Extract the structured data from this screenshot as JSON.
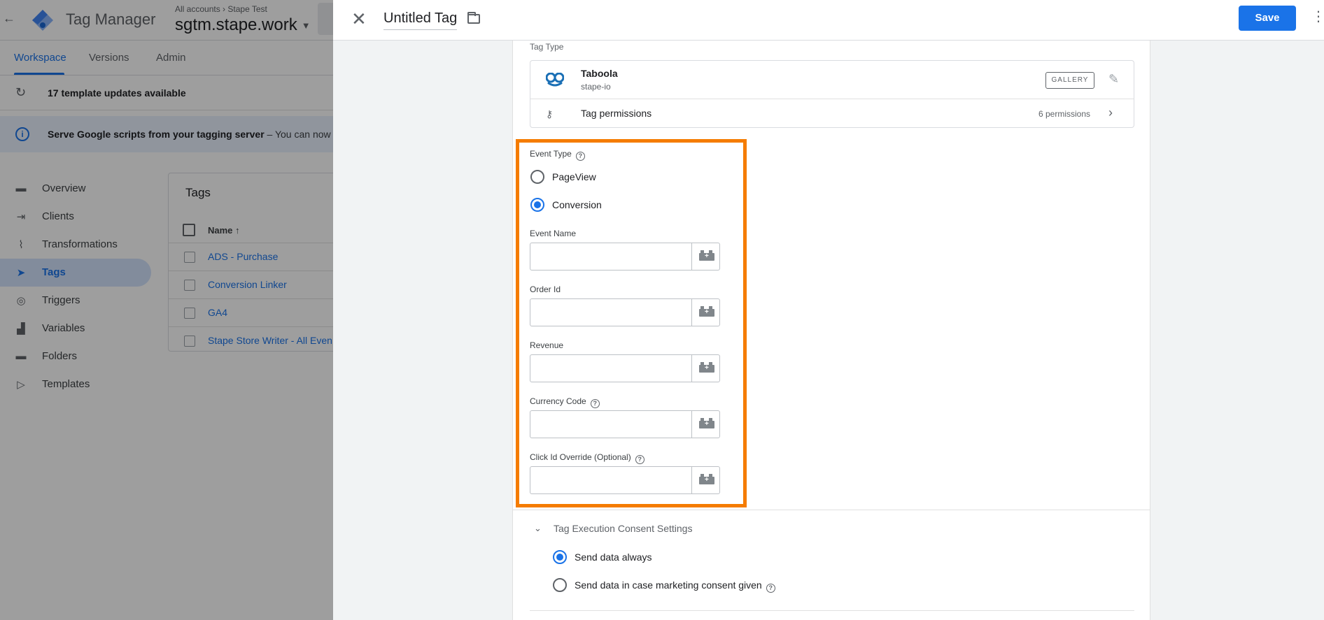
{
  "app": {
    "name": "Tag Manager",
    "breadcrumb": [
      "All accounts",
      "Stape Test"
    ],
    "container": "sgtm.stape.work"
  },
  "nav_tabs": [
    {
      "label": "Workspace",
      "active": true
    },
    {
      "label": "Versions",
      "active": false
    },
    {
      "label": "Admin",
      "active": false
    }
  ],
  "banners": {
    "updates": "17 template updates available",
    "info_strong": "Serve Google scripts from your tagging server",
    "info_rest": "– You can now s"
  },
  "sidebar": {
    "items": [
      {
        "label": "Overview",
        "icon": "folder-icon",
        "active": false
      },
      {
        "label": "Clients",
        "icon": "client-icon",
        "active": false
      },
      {
        "label": "Transformations",
        "icon": "transform-icon",
        "active": false
      },
      {
        "label": "Tags",
        "icon": "tag-icon",
        "active": true
      },
      {
        "label": "Triggers",
        "icon": "trigger-icon",
        "active": false
      },
      {
        "label": "Variables",
        "icon": "variable-icon",
        "active": false
      },
      {
        "label": "Folders",
        "icon": "folder-icon",
        "active": false
      },
      {
        "label": "Templates",
        "icon": "template-icon",
        "active": false
      }
    ]
  },
  "tags_list": {
    "title": "Tags",
    "column_name": "Name",
    "sort": "ascending",
    "rows": [
      "ADS - Purchase",
      "Conversion Linker",
      "GA4",
      "Stape Store Writer - All Even"
    ]
  },
  "panel": {
    "title": "Untitled Tag",
    "save_label": "Save",
    "tag_type_label": "Tag Type",
    "tag_type": {
      "name": "Taboola",
      "vendor": "stape-io",
      "badge": "GALLERY",
      "permissions_label": "Tag permissions",
      "permissions_count": "6 permissions"
    },
    "event_type": {
      "label": "Event Type",
      "options": [
        {
          "label": "PageView",
          "checked": false
        },
        {
          "label": "Conversion",
          "checked": true
        }
      ]
    },
    "fields": [
      {
        "label": "Event Name",
        "value": "",
        "help": false
      },
      {
        "label": "Order Id",
        "value": "",
        "help": false
      },
      {
        "label": "Revenue",
        "value": "",
        "help": false
      },
      {
        "label": "Currency Code",
        "value": "",
        "help": true
      },
      {
        "label": "Click Id Override (Optional)",
        "value": "",
        "help": true
      }
    ],
    "consent": {
      "title": "Tag Execution Consent Settings",
      "options": [
        {
          "label": "Send data always",
          "checked": true
        },
        {
          "label": "Send data in case marketing consent given",
          "checked": false
        }
      ]
    }
  },
  "colors": {
    "accent": "#1a73e8",
    "highlight": "#f57c00",
    "taboola": "#1a6fb5"
  }
}
